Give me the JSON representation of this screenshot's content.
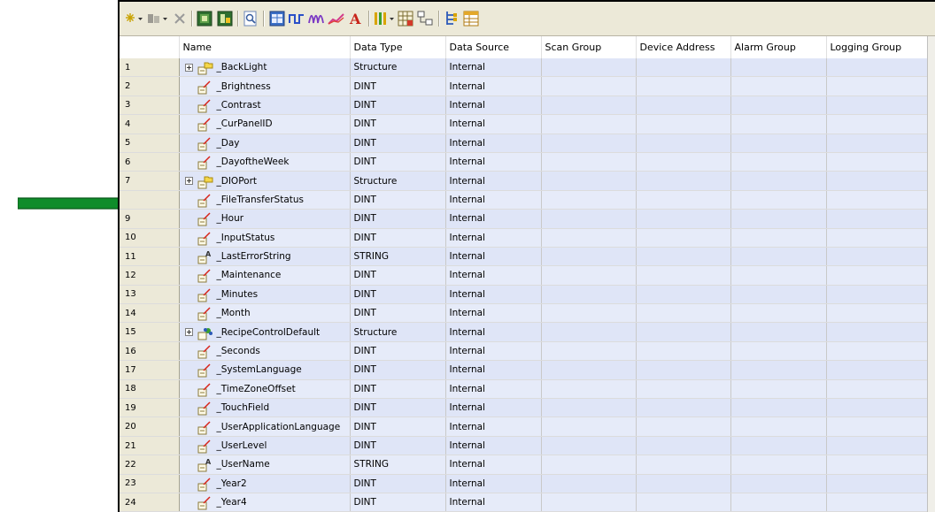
{
  "columns": [
    "Name",
    "Data Type",
    "Data Source",
    "Scan Group",
    "Device Address",
    "Alarm Group",
    "Logging Group"
  ],
  "colors": {
    "arrow": "#0f8c2a",
    "row_bg": "#dfe5f7",
    "toolbar_bg": "#ece9d8"
  },
  "toolbar": {
    "icons": [
      "asterisk-dropdown-icon",
      "database-dropdown-icon",
      "delete-icon",
      "view-grid-icon",
      "view-detail-icon",
      "search-doc-icon",
      "table-view-icon",
      "digital-chart-icon",
      "analog-chart-icon",
      "trend-icon",
      "text-icon",
      "sort-dropdown-icon",
      "grid-icon",
      "structure-icon",
      "tree-icon",
      "table-icon"
    ]
  },
  "rows": [
    {
      "num": "1",
      "name": "_BackLight",
      "icon": "structure",
      "expand": true,
      "type": "Structure",
      "source": "Internal"
    },
    {
      "num": "2",
      "name": "_Brightness",
      "icon": "numeric",
      "expand": false,
      "type": "DINT",
      "source": "Internal"
    },
    {
      "num": "3",
      "name": "_Contrast",
      "icon": "numeric",
      "expand": false,
      "type": "DINT",
      "source": "Internal"
    },
    {
      "num": "4",
      "name": "_CurPanelID",
      "icon": "numeric",
      "expand": false,
      "type": "DINT",
      "source": "Internal"
    },
    {
      "num": "5",
      "name": "_Day",
      "icon": "numeric",
      "expand": false,
      "type": "DINT",
      "source": "Internal"
    },
    {
      "num": "6",
      "name": "_DayoftheWeek",
      "icon": "numeric",
      "expand": false,
      "type": "DINT",
      "source": "Internal"
    },
    {
      "num": "7",
      "name": "_DIOPort",
      "icon": "structure",
      "expand": true,
      "type": "Structure",
      "source": "Internal"
    },
    {
      "num": "",
      "name": "_FileTransferStatus",
      "icon": "numeric",
      "expand": false,
      "type": "DINT",
      "source": "Internal"
    },
    {
      "num": "9",
      "name": "_Hour",
      "icon": "numeric",
      "expand": false,
      "type": "DINT",
      "source": "Internal"
    },
    {
      "num": "10",
      "name": "_InputStatus",
      "icon": "numeric",
      "expand": false,
      "type": "DINT",
      "source": "Internal"
    },
    {
      "num": "11",
      "name": "_LastErrorString",
      "icon": "string",
      "expand": false,
      "type": "STRING",
      "source": "Internal"
    },
    {
      "num": "12",
      "name": "_Maintenance",
      "icon": "numeric",
      "expand": false,
      "type": "DINT",
      "source": "Internal"
    },
    {
      "num": "13",
      "name": "_Minutes",
      "icon": "numeric",
      "expand": false,
      "type": "DINT",
      "source": "Internal"
    },
    {
      "num": "14",
      "name": "_Month",
      "icon": "numeric",
      "expand": false,
      "type": "DINT",
      "source": "Internal"
    },
    {
      "num": "15",
      "name": "_RecipeControlDefault",
      "icon": "recipe",
      "expand": true,
      "type": "Structure",
      "source": "Internal"
    },
    {
      "num": "16",
      "name": "_Seconds",
      "icon": "numeric",
      "expand": false,
      "type": "DINT",
      "source": "Internal"
    },
    {
      "num": "17",
      "name": "_SystemLanguage",
      "icon": "numeric",
      "expand": false,
      "type": "DINT",
      "source": "Internal"
    },
    {
      "num": "18",
      "name": "_TimeZoneOffset",
      "icon": "numeric",
      "expand": false,
      "type": "DINT",
      "source": "Internal"
    },
    {
      "num": "19",
      "name": "_TouchField",
      "icon": "numeric",
      "expand": false,
      "type": "DINT",
      "source": "Internal"
    },
    {
      "num": "20",
      "name": "_UserApplicationLanguage",
      "icon": "numeric",
      "expand": false,
      "type": "DINT",
      "source": "Internal"
    },
    {
      "num": "21",
      "name": "_UserLevel",
      "icon": "numeric",
      "expand": false,
      "type": "DINT",
      "source": "Internal"
    },
    {
      "num": "22",
      "name": "_UserName",
      "icon": "string",
      "expand": false,
      "type": "STRING",
      "source": "Internal"
    },
    {
      "num": "23",
      "name": "_Year2",
      "icon": "numeric",
      "expand": false,
      "type": "DINT",
      "source": "Internal"
    },
    {
      "num": "24",
      "name": "_Year4",
      "icon": "numeric",
      "expand": false,
      "type": "DINT",
      "source": "Internal"
    }
  ]
}
